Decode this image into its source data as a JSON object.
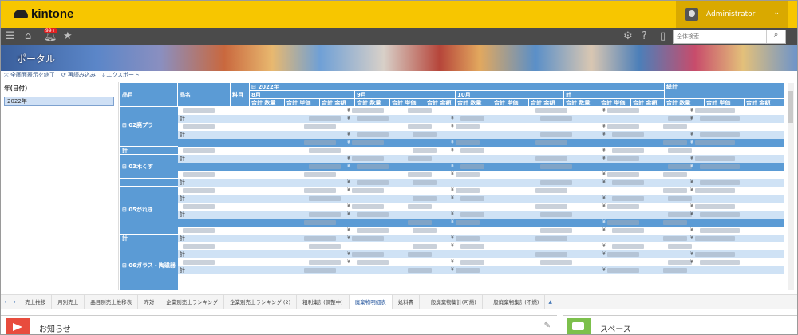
{
  "header": {
    "logo_text": "kintone",
    "user_name": "Administrator"
  },
  "nav": {
    "notification_badge": "99+",
    "search_placeholder": "全体検索"
  },
  "banner": {
    "title": "ポータル"
  },
  "toolbar": {
    "exit_fullscreen": "全画面表示を終了",
    "reload": "再読み込み",
    "export": "エクスポート"
  },
  "filter": {
    "label": "年(日付)",
    "value": "2022年"
  },
  "table": {
    "col_item": "品目",
    "col_name": "品名",
    "col_fee": "料目",
    "year": "2022年",
    "total_label": "総計",
    "months": [
      "8月",
      "9月",
      "10月",
      "計"
    ],
    "measures": [
      "合計 数量",
      "合計 単価",
      "合計 金額"
    ],
    "groups": [
      "02廃プラ",
      "03木くず",
      "05がれき",
      "06ガラス・陶磁器"
    ],
    "subtotal_label": "計",
    "yen": "¥"
  },
  "sheet_tabs": [
    "売上推移",
    "月別売上",
    "品目別売上推移表",
    "昨対",
    "企業別売上ランキング",
    "企業別売上ランキング (2)",
    "粗利集計(調整中)",
    "廃棄物明細表",
    "処料費",
    "一般廃棄物集計(可燃)",
    "一般廃棄物集計(不燃)"
  ],
  "active_tab": "廃棄物明細表",
  "widgets": {
    "notice_title": "お知らせ",
    "space_title": "スペース"
  },
  "colors": {
    "header": "#f7c600",
    "nav": "#4b4b4b",
    "table_header": "#5b9bd5",
    "row_alt": "#cfe2f5"
  }
}
